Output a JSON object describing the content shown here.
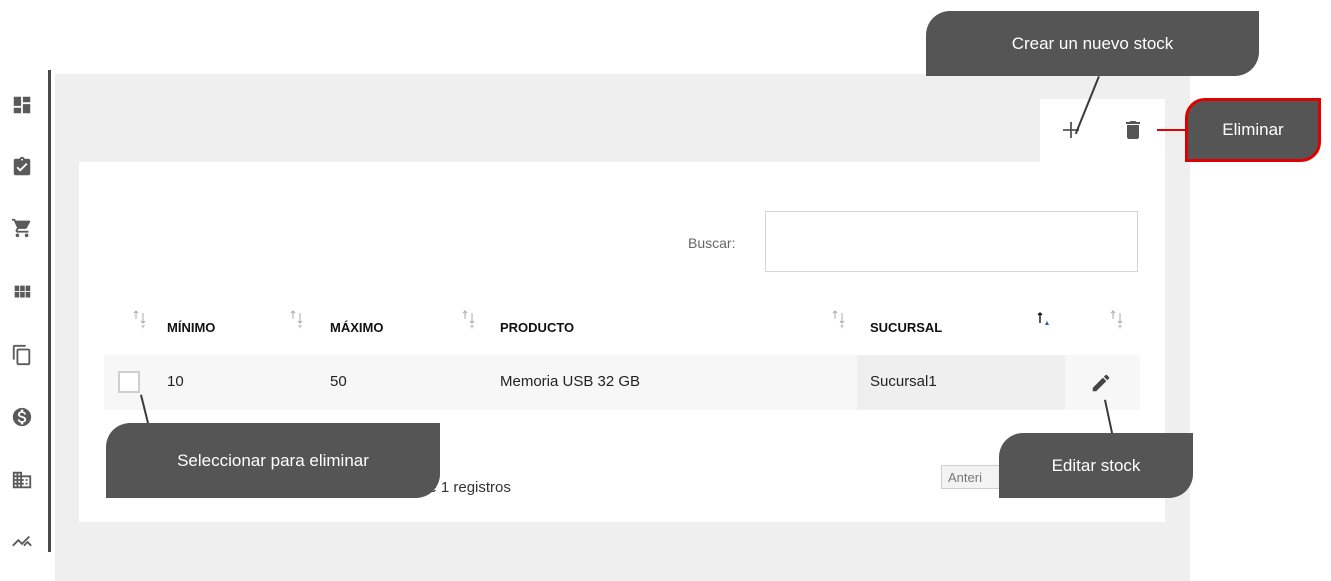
{
  "sidebar": {
    "icons": [
      "dashboard-icon",
      "clipboard-check-icon",
      "cart-icon",
      "grid-icon",
      "copy-icon",
      "dollar-icon",
      "building-icon",
      "trending-icon"
    ]
  },
  "toolbar": {
    "add_icon": "plus-icon",
    "delete_icon": "trash-icon"
  },
  "search": {
    "label": "Buscar:",
    "value": ""
  },
  "table": {
    "columns": [
      "MÍNIMO",
      "MÁXIMO",
      "PRODUCTO",
      "SUCURSAL"
    ],
    "rows": [
      {
        "minimo": "10",
        "maximo": "50",
        "producto": "Memoria USB 32 GB",
        "sucursal": "Sucursal1"
      }
    ]
  },
  "footer": {
    "info_fragment": "de 1 registros",
    "prev_label_fragment": "Anteri"
  },
  "callouts": {
    "new_stock": "Crear un nuevo stock",
    "delete": "Eliminar",
    "select_delete": "Seleccionar para eliminar",
    "edit_stock": "Editar stock"
  },
  "colors": {
    "callout_bg": "#555555",
    "delete_border": "#e00000",
    "sort_active": "#3f51b5"
  }
}
